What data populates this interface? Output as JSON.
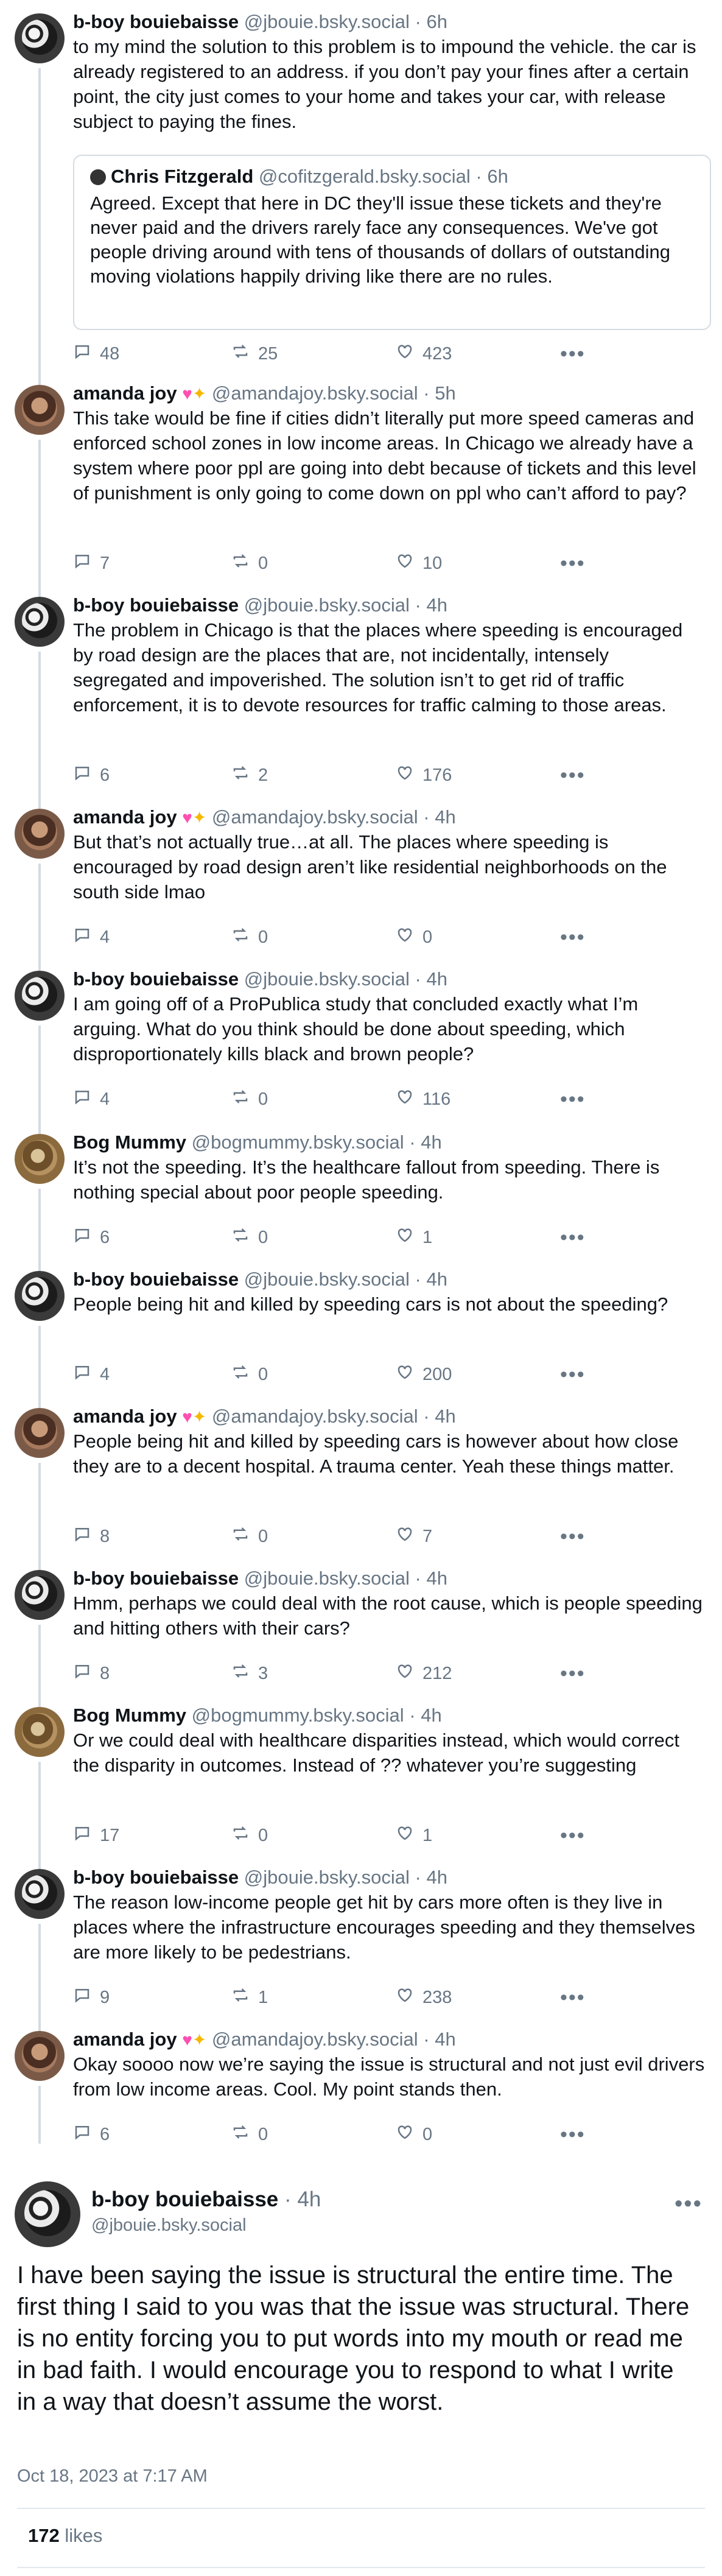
{
  "posts": [
    {
      "name": "b-boy bouiebaisse",
      "handle": "@jbouie.bsky.social",
      "time": "6h",
      "badge": false,
      "avatar": "bboy",
      "text": "to my mind the solution to this problem is to impound the vehicle. the car is already registered to an address. if you don’t pay your fines after a certain point, the city just comes to your home and takes your car, with release subject to paying the fines.",
      "quote": {
        "name": "Chris Fitzgerald",
        "handle": "@cofitzgerald.bsky.social",
        "time": "6h",
        "text": "Agreed. Except that here in DC they'll issue these tickets and they're never paid and the drivers rarely face any consequences. We've got people driving around with tens of thousands of dollars of outstanding moving violations happily driving like there are no rules."
      },
      "replies": "48",
      "reposts": "25",
      "likes": "423"
    },
    {
      "name": "amanda joy",
      "handle": "@amandajoy.bsky.social",
      "time": "5h",
      "badge": true,
      "avatar": "amanda",
      "text": "This take would be fine if cities didn’t literally put more speed cameras and enforced school zones in low income areas. In Chicago we already have a system where poor ppl are going into debt because of tickets and this level of punishment is only going to come down on ppl who can’t afford to pay?",
      "replies": "7",
      "reposts": "0",
      "likes": "10"
    },
    {
      "name": "b-boy bouiebaisse",
      "handle": "@jbouie.bsky.social",
      "time": "4h",
      "badge": false,
      "avatar": "bboy",
      "text": "The problem in Chicago is that the places where speeding is encouraged by road design are the places that are, not incidentally, intensely segregated and impoverished. The solution isn’t to get rid of traffic enforcement, it is to devote resources for traffic calming to those areas.",
      "replies": "6",
      "reposts": "2",
      "likes": "176"
    },
    {
      "name": "amanda joy",
      "handle": "@amandajoy.bsky.social",
      "time": "4h",
      "badge": true,
      "avatar": "amanda",
      "text": "But that’s not actually true…at all. The places where speeding is encouraged by road design aren’t like residential neighborhoods on the south side lmao",
      "replies": "4",
      "reposts": "0",
      "likes": "0"
    },
    {
      "name": "b-boy bouiebaisse",
      "handle": "@jbouie.bsky.social",
      "time": "4h",
      "badge": false,
      "avatar": "bboy",
      "text": "I am going off of a ProPublica study that concluded exactly what I’m arguing. What do you think should be done about speeding, which disproportionately kills black and brown people?",
      "replies": "4",
      "reposts": "0",
      "likes": "116"
    },
    {
      "name": "Bog Mummy",
      "handle": "@bogmummy.bsky.social",
      "time": "4h",
      "badge": false,
      "avatar": "bog",
      "text": "It’s not the speeding.  It’s the healthcare fallout from speeding.  There is nothing special about poor people speeding.",
      "replies": "6",
      "reposts": "0",
      "likes": "1"
    },
    {
      "name": "b-boy bouiebaisse",
      "handle": "@jbouie.bsky.social",
      "time": "4h",
      "badge": false,
      "avatar": "bboy",
      "text": "People being hit and killed by speeding cars is not about the speeding?",
      "replies": "4",
      "reposts": "0",
      "likes": "200"
    },
    {
      "name": "amanda joy",
      "handle": "@amandajoy.bsky.social",
      "time": "4h",
      "badge": true,
      "avatar": "amanda",
      "text": "People being hit and killed by speeding cars is however about how close they are to a decent hospital. A trauma center. Yeah these things matter.",
      "replies": "8",
      "reposts": "0",
      "likes": "7"
    },
    {
      "name": "b-boy bouiebaisse",
      "handle": "@jbouie.bsky.social",
      "time": "4h",
      "badge": false,
      "avatar": "bboy",
      "text": "Hmm, perhaps we could deal with the root cause, which is people speeding and hitting others with their cars?",
      "replies": "8",
      "reposts": "3",
      "likes": "212"
    },
    {
      "name": "Bog Mummy",
      "handle": "@bogmummy.bsky.social",
      "time": "4h",
      "badge": false,
      "avatar": "bog",
      "text": "Or we could deal with healthcare disparities instead, which would correct the disparity in outcomes.  Instead of ??  whatever you’re suggesting",
      "replies": "17",
      "reposts": "0",
      "likes": "1"
    },
    {
      "name": "b-boy bouiebaisse",
      "handle": "@jbouie.bsky.social",
      "time": "4h",
      "badge": false,
      "avatar": "bboy",
      "text": "The reason low-income people get hit by cars more often is they live in places where the infrastructure encourages speeding and they themselves are more likely to be pedestrians.",
      "replies": "9",
      "reposts": "1",
      "likes": "238"
    },
    {
      "name": "amanda joy",
      "handle": "@amandajoy.bsky.social",
      "time": "4h",
      "badge": true,
      "avatar": "amanda",
      "text": "Okay soooo now we’re saying the issue is structural and not just evil drivers from low income areas. Cool. My point stands then.",
      "replies": "6",
      "reposts": "0",
      "likes": "0"
    }
  ],
  "main_post": {
    "name": "b-boy bouiebaisse",
    "time": "4h",
    "handle": "@jbouie.bsky.social",
    "text": "I have been saying the issue is structural the entire time. The first thing I said to you was that the issue was structural. There is no entity forcing you to put words into my mouth or read me in bad faith. I would encourage you to respond to what I write in a way that doesn’t assume the worst.",
    "date": "Oct 18, 2023 at 7:17 AM",
    "likes_count": "172",
    "likes_label": "likes"
  },
  "icons": {
    "reply": "speech-bubble-icon",
    "repost": "repost-arrows-icon",
    "like": "heart-outline-icon",
    "more": "ellipsis-icon"
  },
  "colors": {
    "text": "#0f1419",
    "muted": "#687684",
    "rail": "#d4dbe2",
    "accent_heart": "#ff4fb0"
  }
}
